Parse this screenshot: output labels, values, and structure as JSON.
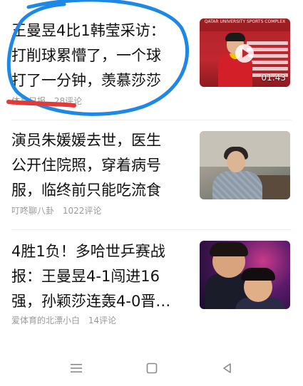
{
  "feed": {
    "items": [
      {
        "title": "王曼昱4比1韩莹采访：\n打削球累懵了，一个球\n打了一分钟，羡慕莎莎",
        "source": "体育日报",
        "comments": "28评论",
        "thumb_duration": "01:43",
        "thumb_banner": "QATAR UNIVERSITY SPORTS COMPLEX"
      },
      {
        "title": "演员朱媛媛去世，医生\n公开住院照，穿着病号\n服，临终前只能吃流食",
        "source": "叮咚聊八卦",
        "comments": "1022评论"
      },
      {
        "title": "4胜1负！多哈世乒赛战\n报：王曼昱4-1闯进16\n强，孙颖莎连轰4-0晋…",
        "source": "爱体育的北漂小白",
        "comments": "14评论"
      }
    ]
  },
  "colors": {
    "annotation_circle": "#1e88e5",
    "annotation_underline": "#e53935",
    "meta_text": "#9a9a9a"
  },
  "navbar": {
    "menu_icon": "menu-icon",
    "home_icon": "home-square-icon",
    "back_icon": "back-triangle-icon"
  }
}
